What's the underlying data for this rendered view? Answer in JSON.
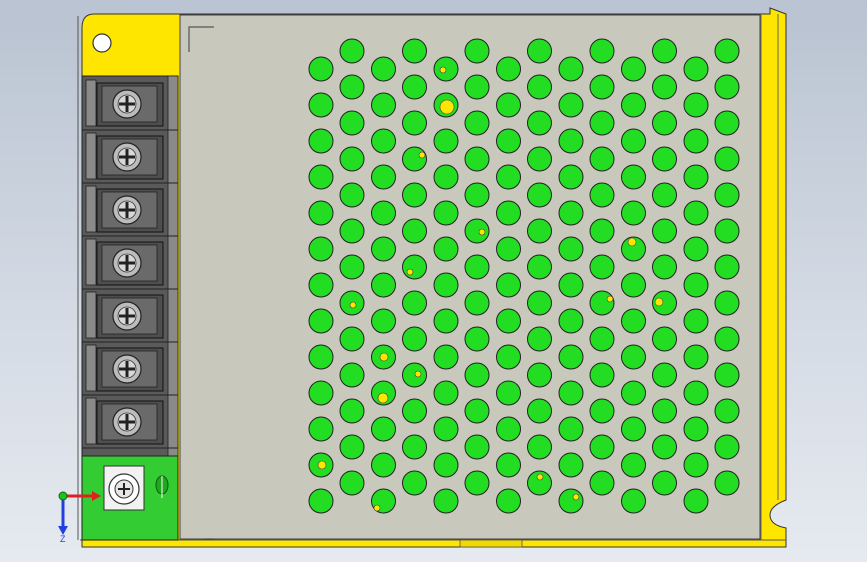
{
  "viewport": {
    "background_top": "#b9c3d1",
    "background_bottom": "#e6eaf0"
  },
  "model": {
    "housing_color": "#ffe600",
    "cover_color": "#c8c8bc",
    "vent_hole_color": "#22dd22",
    "terminal_block_color": "#5a5a5a",
    "pcb_color": "#33cc33",
    "terminal_count": 7,
    "vent_grid": {
      "odd_columns": 7,
      "even_columns": 7,
      "rows": 13
    }
  },
  "triad": {
    "x_axis_color": "#e02020",
    "y_axis_color": "#20c020",
    "z_axis_color": "#2040e0",
    "z_label": "Z"
  }
}
